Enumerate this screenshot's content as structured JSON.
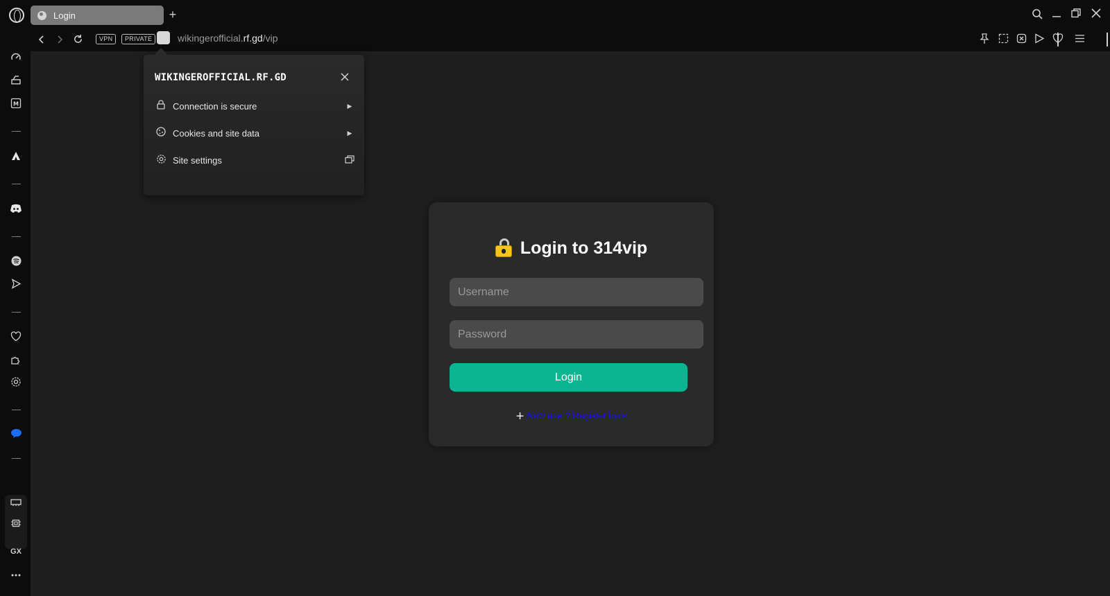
{
  "browser": {
    "tab": {
      "title": "Login",
      "icon": "globe-icon"
    },
    "address": {
      "badges": [
        "VPN",
        "PRIVATE"
      ],
      "url_prefix": "wikingerofficial.",
      "url_domain": "rf.gd",
      "url_path": "/vip"
    },
    "sidebar": {
      "gx_label": "GX"
    }
  },
  "site_popup": {
    "title": "WIKINGEROFFICIAL.RF.GD",
    "items": [
      {
        "label": "Connection is secure",
        "icon": "lock-icon"
      },
      {
        "label": "Cookies and site data",
        "icon": "cookie-icon"
      },
      {
        "label": "Site settings",
        "icon": "gear-icon"
      }
    ]
  },
  "login": {
    "emoji": "locked-with-key",
    "title": "Login to 314vip",
    "username_placeholder": "Username",
    "password_placeholder": "Password",
    "button_label": "Login",
    "register_link": "New user? Register here"
  },
  "colors": {
    "accent": "#0bb593",
    "card_bg": "#2a2a2a",
    "page_bg": "#1f1f1f",
    "link": "#1a0dff"
  }
}
